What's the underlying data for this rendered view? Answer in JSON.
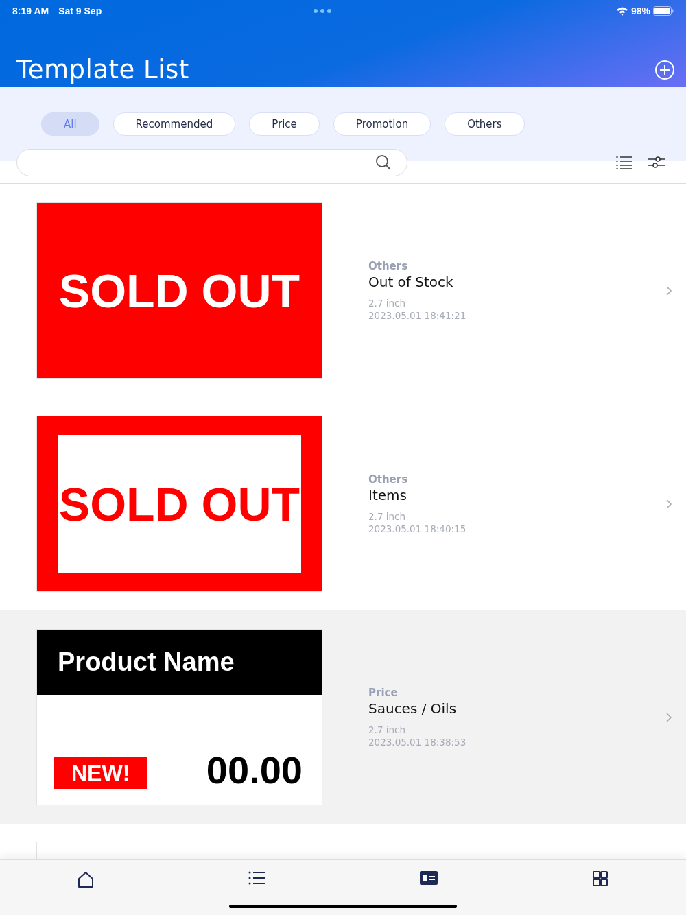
{
  "status_bar": {
    "time": "8:19 AM",
    "date": "Sat 9 Sep",
    "battery": "98%"
  },
  "header": {
    "title": "Template List"
  },
  "filters": [
    {
      "label": "All",
      "selected": true
    },
    {
      "label": "Recommended",
      "selected": false
    },
    {
      "label": "Price",
      "selected": false
    },
    {
      "label": "Promotion",
      "selected": false
    },
    {
      "label": "Others",
      "selected": false
    }
  ],
  "templates": [
    {
      "preview": {
        "kind": "sold_out_fill",
        "text": "SOLD OUT"
      },
      "category": "Others",
      "name": "Out of Stock",
      "size": "2.7 inch",
      "date": "2023.05.01 18:41:21",
      "selected": false
    },
    {
      "preview": {
        "kind": "sold_out_frame",
        "text": "SOLD OUT"
      },
      "category": "Others",
      "name": "Items",
      "size": "2.7 inch",
      "date": "2023.05.01 18:40:15",
      "selected": false
    },
    {
      "preview": {
        "kind": "price_tag",
        "text": "Product Name",
        "badge": "NEW!",
        "price": "00.00"
      },
      "category": "Price",
      "name": "Sauces / Oils",
      "size": "2.7 inch",
      "date": "2023.05.01 18:38:53",
      "selected": true
    }
  ],
  "tab_bar": [
    {
      "kind": "home",
      "selected": false
    },
    {
      "kind": "list",
      "selected": false
    },
    {
      "kind": "card",
      "selected": true
    },
    {
      "kind": "grid",
      "selected": false
    }
  ]
}
